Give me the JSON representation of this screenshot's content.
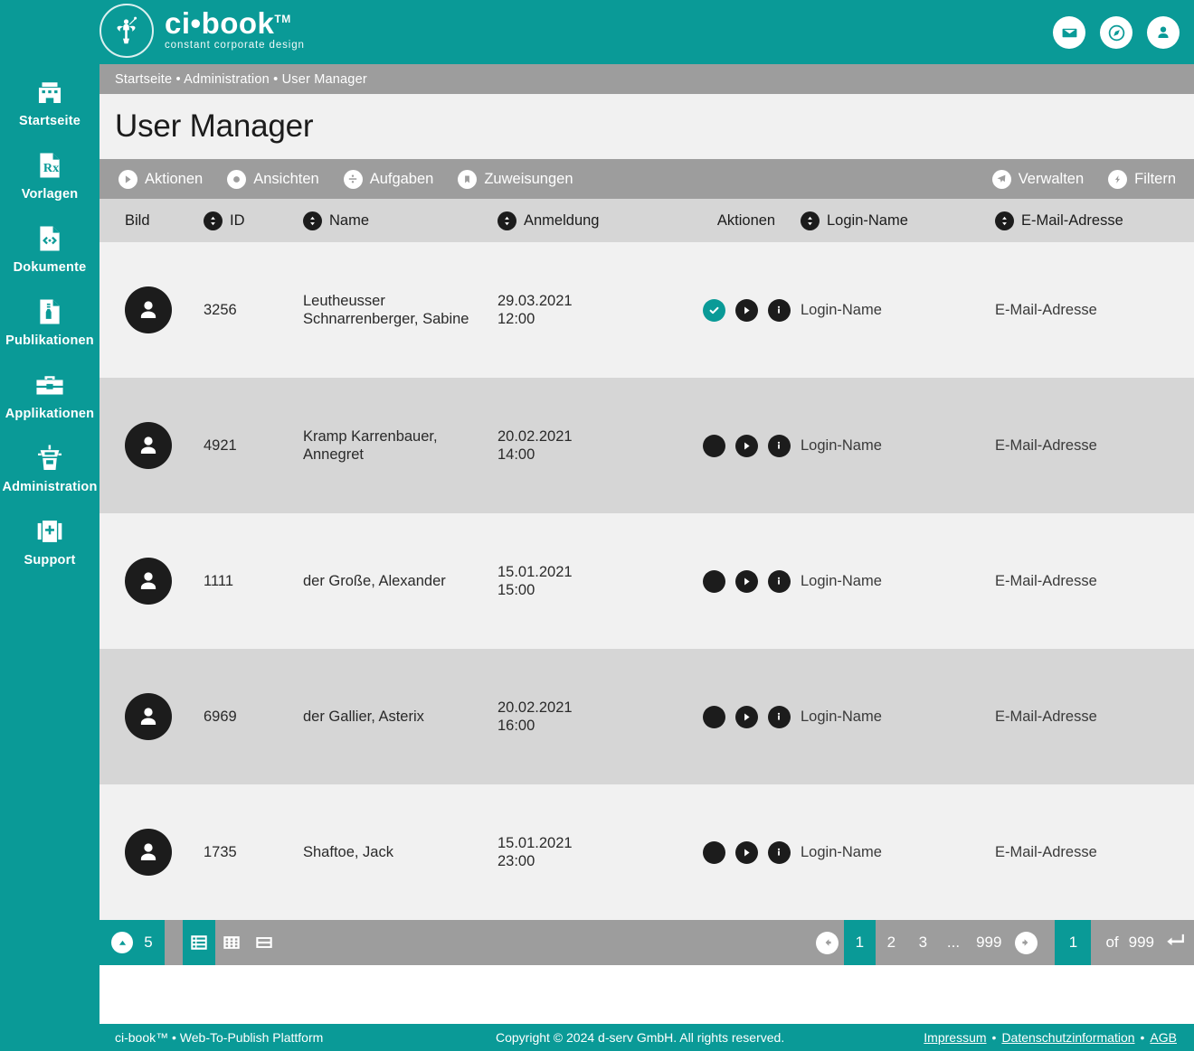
{
  "brand": {
    "name": "ci•book",
    "tm": "TM",
    "tagline": "constant corporate design",
    "color": "#0a9a97"
  },
  "header": {
    "icons": [
      {
        "name": "mail-icon",
        "label": "Nachrichten"
      },
      {
        "name": "compass-icon",
        "label": "Entdecken"
      },
      {
        "name": "account-icon",
        "label": "Benutzerkonto"
      }
    ]
  },
  "sidebar": {
    "items": [
      {
        "label": "Startseite",
        "icon": "building-icon"
      },
      {
        "label": "Vorlagen",
        "icon": "rx-document-icon"
      },
      {
        "label": "Dokumente",
        "icon": "code-document-icon"
      },
      {
        "label": "Publikationen",
        "icon": "bottle-document-icon"
      },
      {
        "label": "Applikationen",
        "icon": "toolbox-icon"
      },
      {
        "label": "Administration",
        "icon": "control-tower-icon"
      },
      {
        "label": "Support",
        "icon": "first-aid-icon"
      }
    ]
  },
  "breadcrumb": "Startseite • Administration • User Manager",
  "page": {
    "title": "User Manager"
  },
  "toolbar": {
    "left": [
      {
        "label": "Aktionen",
        "icon": "play-circle-icon"
      },
      {
        "label": "Ansichten",
        "icon": "dot-circle-icon"
      },
      {
        "label": "Aufgaben",
        "icon": "divide-circle-icon"
      },
      {
        "label": "Zuweisungen",
        "icon": "bookmark-circle-icon"
      }
    ],
    "right": [
      {
        "label": "Verwalten",
        "icon": "paper-plane-circle-icon"
      },
      {
        "label": "Filtern",
        "icon": "bolt-circle-icon"
      }
    ]
  },
  "table": {
    "columns": [
      {
        "label": "Bild",
        "sortable": false
      },
      {
        "label": "ID",
        "sortable": true
      },
      {
        "label": "Name",
        "sortable": true
      },
      {
        "label": "Anmeldung",
        "sortable": true
      },
      {
        "label": "Aktionen",
        "sortable": false
      },
      {
        "label": "Login-Name",
        "sortable": true
      },
      {
        "label": "E-Mail-Adresse",
        "sortable": true
      }
    ],
    "rows": [
      {
        "id": "3256",
        "name_line1": "Leutheusser",
        "name_line2": "Schnarrenberger, Sabine",
        "date": "29.03.2021",
        "time": "12:00",
        "selected": true,
        "login": "Login-Name",
        "email": "E-Mail-Adresse"
      },
      {
        "id": "4921",
        "name_line1": "Kramp Karrenbauer,",
        "name_line2": "Annegret",
        "date": "20.02.2021",
        "time": "14:00",
        "selected": false,
        "login": "Login-Name",
        "email": "E-Mail-Adresse"
      },
      {
        "id": "1111",
        "name_line1": "der Große, Alexander",
        "name_line2": "",
        "date": "15.01.2021",
        "time": "15:00",
        "selected": false,
        "login": "Login-Name",
        "email": "E-Mail-Adresse"
      },
      {
        "id": "6969",
        "name_line1": "der Gallier, Asterix",
        "name_line2": "",
        "date": "20.02.2021",
        "time": "16:00",
        "selected": false,
        "login": "Login-Name",
        "email": "E-Mail-Adresse"
      },
      {
        "id": "1735",
        "name_line1": "Shaftoe, Jack",
        "name_line2": "",
        "date": "15.01.2021",
        "time": "23:00",
        "selected": false,
        "login": "Login-Name",
        "email": "E-Mail-Adresse"
      }
    ]
  },
  "pager": {
    "page_size": "5",
    "views": [
      {
        "name": "list-view-icon",
        "active": true
      },
      {
        "name": "grid-view-icon",
        "active": false
      },
      {
        "name": "split-view-icon",
        "active": false
      }
    ],
    "pages": [
      "1",
      "2",
      "3"
    ],
    "dots": "...",
    "last_page": "999",
    "current_page": "1",
    "jump_value": "1",
    "of_label": "of",
    "total_pages": "999"
  },
  "footer": {
    "left": "ci-book™ • Web-To-Publish Plattform",
    "copyright": "Copyright © 2024 d-serv GmbH. All rights reserved.",
    "links": [
      "Impressum",
      "Datenschutzinformation",
      "AGB"
    ],
    "link_sep": "•"
  }
}
